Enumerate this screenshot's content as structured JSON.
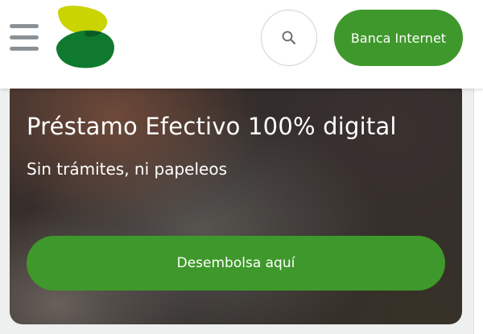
{
  "header": {
    "menu_icon": "hamburger-menu-icon",
    "logo_icon": "bank-logo-icon",
    "search_icon": "search-icon",
    "banca_internet_label": "Banca Internet"
  },
  "hero": {
    "title": "Préstamo Efectivo 100% digital",
    "subtitle": "Sin trámites, ni papeleos",
    "cta_label": "Desembolsa aquí"
  },
  "colors": {
    "brand_green": "#3f982b",
    "logo_lime": "#c9d400",
    "logo_green": "#0f7a2e",
    "logo_dark_green": "#0a5a24"
  }
}
